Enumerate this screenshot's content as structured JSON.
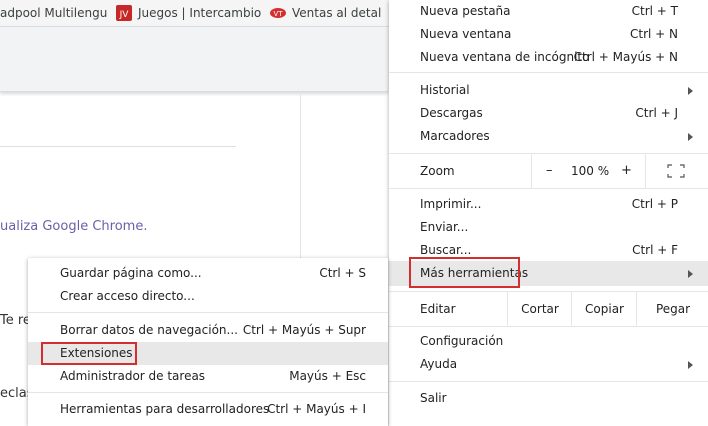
{
  "bookmarks": [
    {
      "label": "adpool Multilengu",
      "icon": "bookmark-icon"
    },
    {
      "label": "Juegos | Intercambio",
      "icon": "jv-icon"
    },
    {
      "label": "Ventas al detal",
      "icon": "vt-icon"
    }
  ],
  "page": {
    "link_text": "ualiza Google Chrome.",
    "cut_text_1": "Te re",
    "cut_text_2": "eclas"
  },
  "main_menu": {
    "new_tab": {
      "label": "Nueva pestaña",
      "shortcut": "Ctrl + T"
    },
    "new_window": {
      "label": "Nueva ventana",
      "shortcut": "Ctrl + N"
    },
    "incognito": {
      "label": "Nueva ventana de incógnito",
      "shortcut": "Ctrl + Mayús + N"
    },
    "history": {
      "label": "Historial"
    },
    "downloads": {
      "label": "Descargas",
      "shortcut": "Ctrl + J"
    },
    "bookmarks": {
      "label": "Marcadores"
    },
    "zoom": {
      "label": "Zoom",
      "minus": "–",
      "value": "100 %",
      "plus": "+"
    },
    "print": {
      "label": "Imprimir...",
      "shortcut": "Ctrl + P"
    },
    "send": {
      "label": "Enviar..."
    },
    "find": {
      "label": "Buscar...",
      "shortcut": "Ctrl + F"
    },
    "more_tools": {
      "label": "Más herramientas"
    },
    "edit": {
      "label": "Editar",
      "cut": "Cortar",
      "copy": "Copiar",
      "paste": "Pegar"
    },
    "settings": {
      "label": "Configuración"
    },
    "help": {
      "label": "Ayuda"
    },
    "exit": {
      "label": "Salir"
    }
  },
  "sub_menu": {
    "save_page": {
      "label": "Guardar página como...",
      "shortcut": "Ctrl + S"
    },
    "shortcut": {
      "label": "Crear acceso directo..."
    },
    "clear_data": {
      "label": "Borrar datos de navegación...",
      "shortcut": "Ctrl + Mayús + Supr"
    },
    "extensions": {
      "label": "Extensiones"
    },
    "task_manager": {
      "label": "Administrador de tareas",
      "shortcut": "Mayús + Esc"
    },
    "dev_tools": {
      "label": "Herramientas para desarrolladores",
      "shortcut": "Ctrl + Mayús + I"
    }
  },
  "colors": {
    "highlight_outline": "#d32f2f",
    "link": "#6c5fa7"
  }
}
